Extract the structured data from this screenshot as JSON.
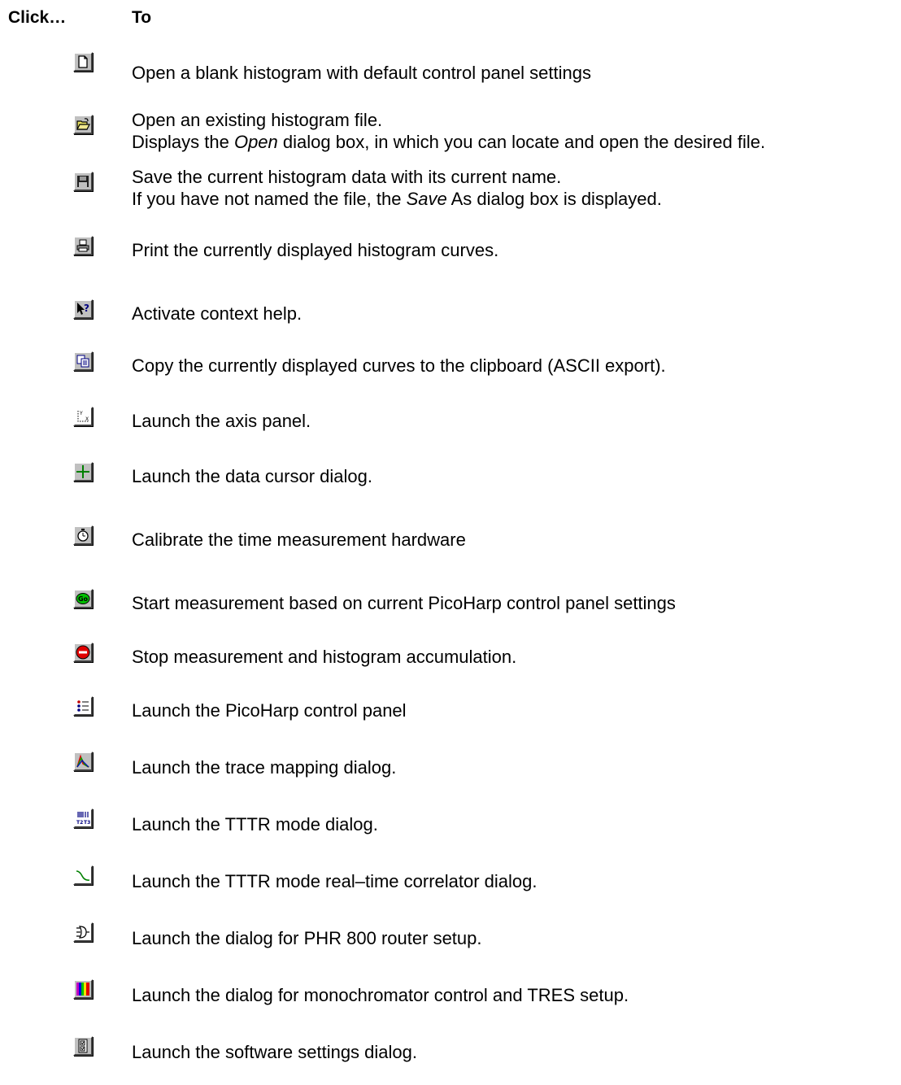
{
  "header": {
    "click": "Click…",
    "to": "To"
  },
  "rows": [
    {
      "icon": "new-document-icon",
      "lines": [
        "Open a blank histogram with default control panel settings"
      ]
    },
    {
      "icon": "open-folder-icon",
      "lines": [
        "Open an existing histogram file."
      ],
      "line2_pre": "Displays the ",
      "line2_em": "Open",
      "line2_post": " dialog box, in which you can locate and open the desired file."
    },
    {
      "icon": "save-disk-icon",
      "lines": [
        "Save the current histogram data with its current name."
      ],
      "line2_pre": "If you have not named the file, the ",
      "line2_em": "Save",
      "line2_post": " As dialog box is displayed."
    },
    {
      "icon": "printer-icon",
      "lines": [
        "Print the currently displayed histogram curves."
      ]
    },
    {
      "icon": "context-help-icon",
      "lines": [
        "Activate context help."
      ]
    },
    {
      "icon": "copy-icon",
      "lines": [
        "Copy the currently displayed curves to the clipboard (ASCII export)."
      ]
    },
    {
      "icon": "axis-panel-icon",
      "lines": [
        "Launch the axis panel."
      ]
    },
    {
      "icon": "data-cursor-icon",
      "lines": [
        "Launch the data cursor dialog."
      ]
    },
    {
      "icon": "stopwatch-icon",
      "lines": [
        "Calibrate the time measurement hardware"
      ]
    },
    {
      "icon": "go-icon",
      "lines": [
        "Start measurement based on current PicoHarp control panel settings"
      ],
      "go_text": "Go"
    },
    {
      "icon": "stop-icon",
      "lines": [
        "Stop measurement and histogram accumulation."
      ]
    },
    {
      "icon": "control-panel-icon",
      "lines": [
        "Launch the PicoHarp control panel"
      ]
    },
    {
      "icon": "trace-mapping-icon",
      "lines": [
        "Launch the trace mapping dialog."
      ]
    },
    {
      "icon": "tttr-mode-icon",
      "lines": [
        "Launch the TTTR mode dialog."
      ],
      "t2": "T2",
      "t3": "T3"
    },
    {
      "icon": "correlator-icon",
      "lines": [
        "Launch the TTTR mode real–time correlator dialog."
      ]
    },
    {
      "icon": "router-icon",
      "lines": [
        "Launch the dialog for PHR 800 router setup."
      ]
    },
    {
      "icon": "monochromator-icon",
      "lines": [
        "Launch the dialog for monochromator control and TRES setup."
      ]
    },
    {
      "icon": "settings-icon",
      "lines": [
        "Launch the software settings dialog."
      ]
    }
  ]
}
